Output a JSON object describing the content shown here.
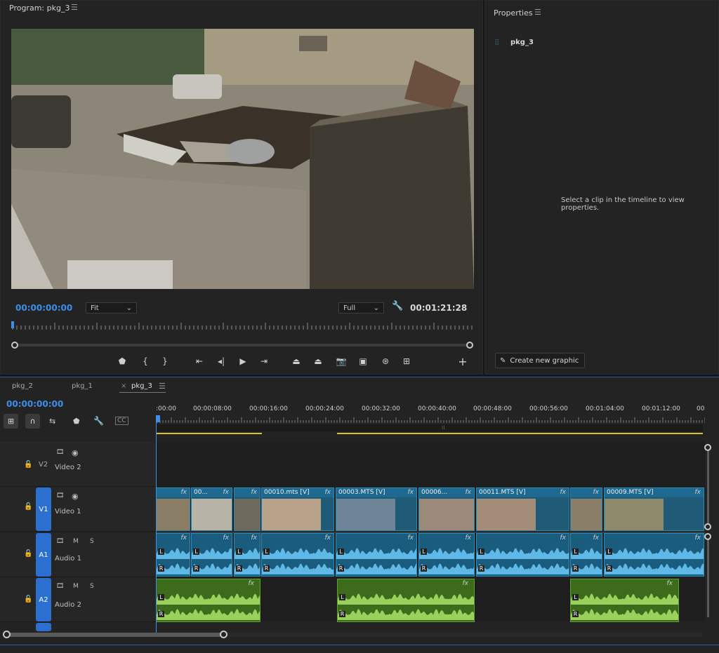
{
  "program": {
    "title": "Program: pkg_3",
    "menu_icon": "hamburger-menu-icon",
    "timecode_current": "00:00:00:00",
    "zoom": "Fit",
    "resolution": "Full",
    "timecode_duration": "00:01:21:28"
  },
  "properties": {
    "title": "Properties",
    "sequence_name": "pkg_3",
    "empty_message": "Select a clip in the timeline to view properties.",
    "create_graphic": "Create new graphic"
  },
  "timeline": {
    "tabs": [
      {
        "label": "pkg_2"
      },
      {
        "label": "pkg_1"
      },
      {
        "label": "pkg_3",
        "close": "×"
      }
    ],
    "timecode": "00:00:00:00",
    "ruler": [
      ":00:00",
      "00:00:08:00",
      "00:00:16:00",
      "00:00:24:00",
      "00:00:32:00",
      "00:00:40:00",
      "00:00:48:00",
      "00:00:56:00",
      "00:01:04:00",
      "00:01:12:00",
      "00"
    ],
    "tracks": {
      "v2": {
        "badge": "V2",
        "name": "Video 2"
      },
      "v1": {
        "badge": "V1",
        "name": "Video 1"
      },
      "a1": {
        "badge": "A1",
        "name": "Audio 1",
        "m": "M",
        "s": "S"
      },
      "a2": {
        "badge": "A2",
        "name": "Audio 2",
        "m": "M",
        "s": "S"
      }
    },
    "video_clips": [
      "",
      "00...",
      "",
      "00010.mts [V]",
      "00003.MTS [V]",
      "00006...",
      "00011.MTS [V]",
      "",
      "00009.MTS [V]"
    ],
    "fx_label": "fx",
    "channel_left": "L",
    "channel_right": "R"
  },
  "colors": {
    "accent_blue": "#3d8ee8",
    "track_badge": "#2b6fd0",
    "video_clip": "#1f5a76",
    "audio1_clip": "#1a5c7e",
    "audio2_clip": "#3c6b1c",
    "work_area": "#d9c22b"
  }
}
